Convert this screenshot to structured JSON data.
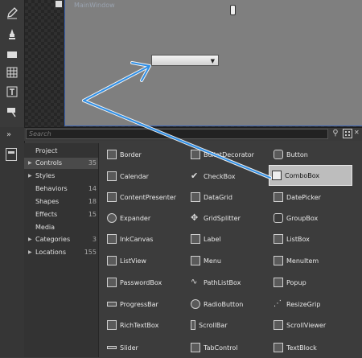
{
  "artboard": {
    "window_title": "MainWindow"
  },
  "toolbar": {
    "tools": [
      "pen-icon",
      "brush-icon",
      "rectangle-icon",
      "grid-icon",
      "text-tool-icon",
      "hand-icon"
    ]
  },
  "asset_panel": {
    "search": {
      "placeholder": "Search"
    },
    "categories": [
      {
        "label": "Project",
        "count": "",
        "expandable": false,
        "selected": false
      },
      {
        "label": "Controls",
        "count": "35",
        "expandable": true,
        "selected": true
      },
      {
        "label": "Styles",
        "count": "",
        "expandable": true,
        "selected": false
      },
      {
        "label": "Behaviors",
        "count": "14",
        "expandable": false,
        "selected": false
      },
      {
        "label": "Shapes",
        "count": "18",
        "expandable": false,
        "selected": false
      },
      {
        "label": "Effects",
        "count": "15",
        "expandable": false,
        "selected": false
      },
      {
        "label": "Media",
        "count": "",
        "expandable": false,
        "selected": false
      },
      {
        "label": "Categories",
        "count": "3",
        "expandable": true,
        "selected": false
      },
      {
        "label": "Locations",
        "count": "155",
        "expandable": true,
        "selected": false
      }
    ],
    "assets": [
      [
        "Border",
        "BulletDecorator",
        "Button"
      ],
      [
        "Calendar",
        "CheckBox",
        "ComboBox"
      ],
      [
        "ContentPresenter",
        "DataGrid",
        "DatePicker"
      ],
      [
        "Expander",
        "GridSplitter",
        "GroupBox"
      ],
      [
        "InkCanvas",
        "Label",
        "ListBox"
      ],
      [
        "ListView",
        "Menu",
        "MenuItem"
      ],
      [
        "PasswordBox",
        "PathListBox",
        "Popup"
      ],
      [
        "ProgressBar",
        "RadioButton",
        "ResizeGrip"
      ],
      [
        "RichTextBox",
        "ScrollBar",
        "ScrollViewer"
      ],
      [
        "Slider",
        "TabControl",
        "TextBlock"
      ]
    ],
    "selected_asset": "ComboBox"
  },
  "colors": {
    "accent_arrow": "#2f8fe6",
    "window_border": "#3c64b4"
  }
}
